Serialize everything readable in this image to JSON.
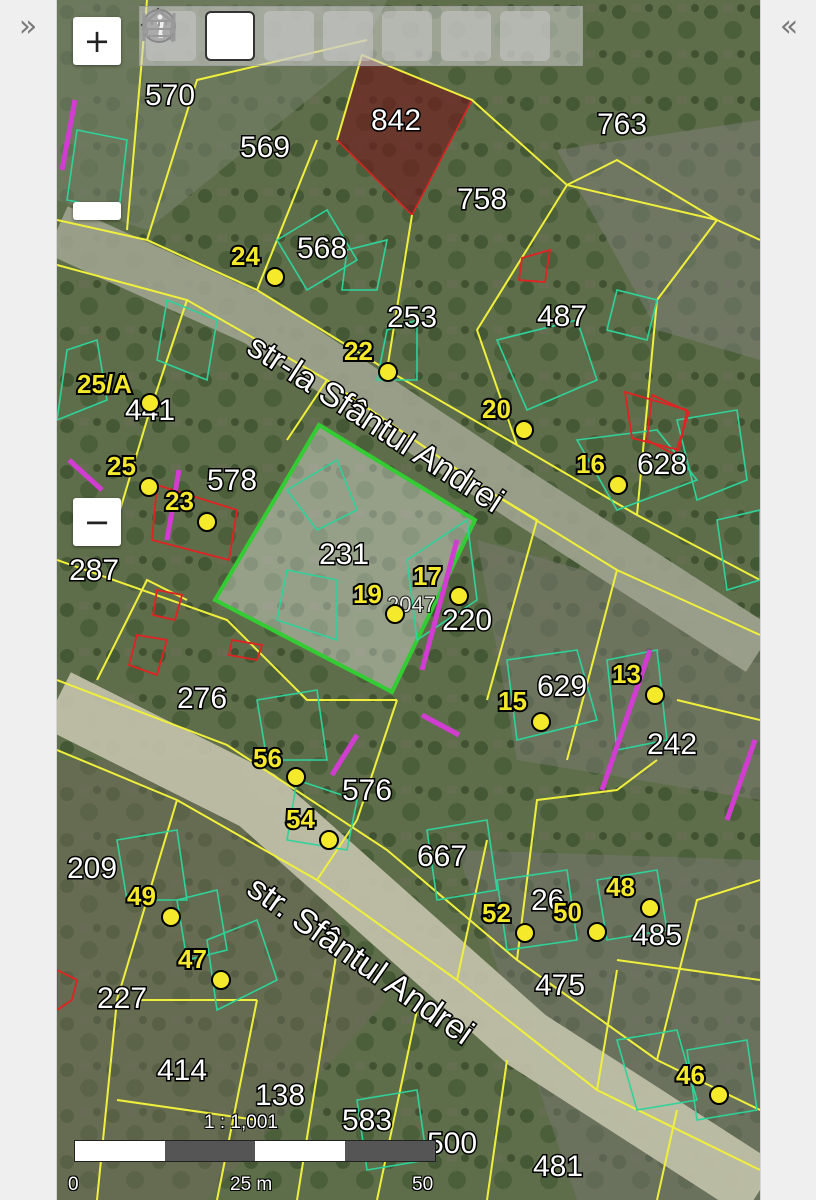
{
  "panels": {
    "left_toggle": "»",
    "right_toggle": "«"
  },
  "zoom": {
    "in_label": "+",
    "out_label": "−"
  },
  "toolbar": {
    "tools": [
      "globe-icon",
      "pan-icon",
      "zoom-in-icon",
      "zoom-out-icon",
      "info-icon",
      "measure-length-icon",
      "measure-area-icon"
    ],
    "active": "pan-icon"
  },
  "streets": [
    {
      "name": "str-la Sfântul Andrei"
    },
    {
      "name": "str. Sfântul Andrei"
    }
  ],
  "parcels": [
    "570",
    "569",
    "842",
    "763",
    "758",
    "568",
    "253",
    "487",
    "441",
    "628",
    "578",
    "231",
    "287",
    "220",
    "629",
    "242",
    "276",
    "576",
    "667",
    "209",
    "26",
    "485",
    "227",
    "475",
    "414",
    "138",
    "583",
    "500",
    "481"
  ],
  "house_numbers": [
    "25/A",
    "24",
    "22",
    "20",
    "16",
    "25",
    "23",
    "19",
    "17",
    "13",
    "15",
    "56",
    "54",
    "49",
    "52",
    "50",
    "48",
    "47",
    "46"
  ],
  "overlapping_label": "2047",
  "scale": {
    "ratio": "1 : 1,001",
    "ticks": [
      "0",
      "25 m",
      "50 m"
    ]
  },
  "colors": {
    "parcel_line": "#f0f03c",
    "building_line": "#2ed39a",
    "selected_parcel": "#33cc33",
    "red_building": "#e22222",
    "fence": "#d13cd1",
    "highlight_fill": "#6e2020",
    "marker": "#f5e92c"
  }
}
